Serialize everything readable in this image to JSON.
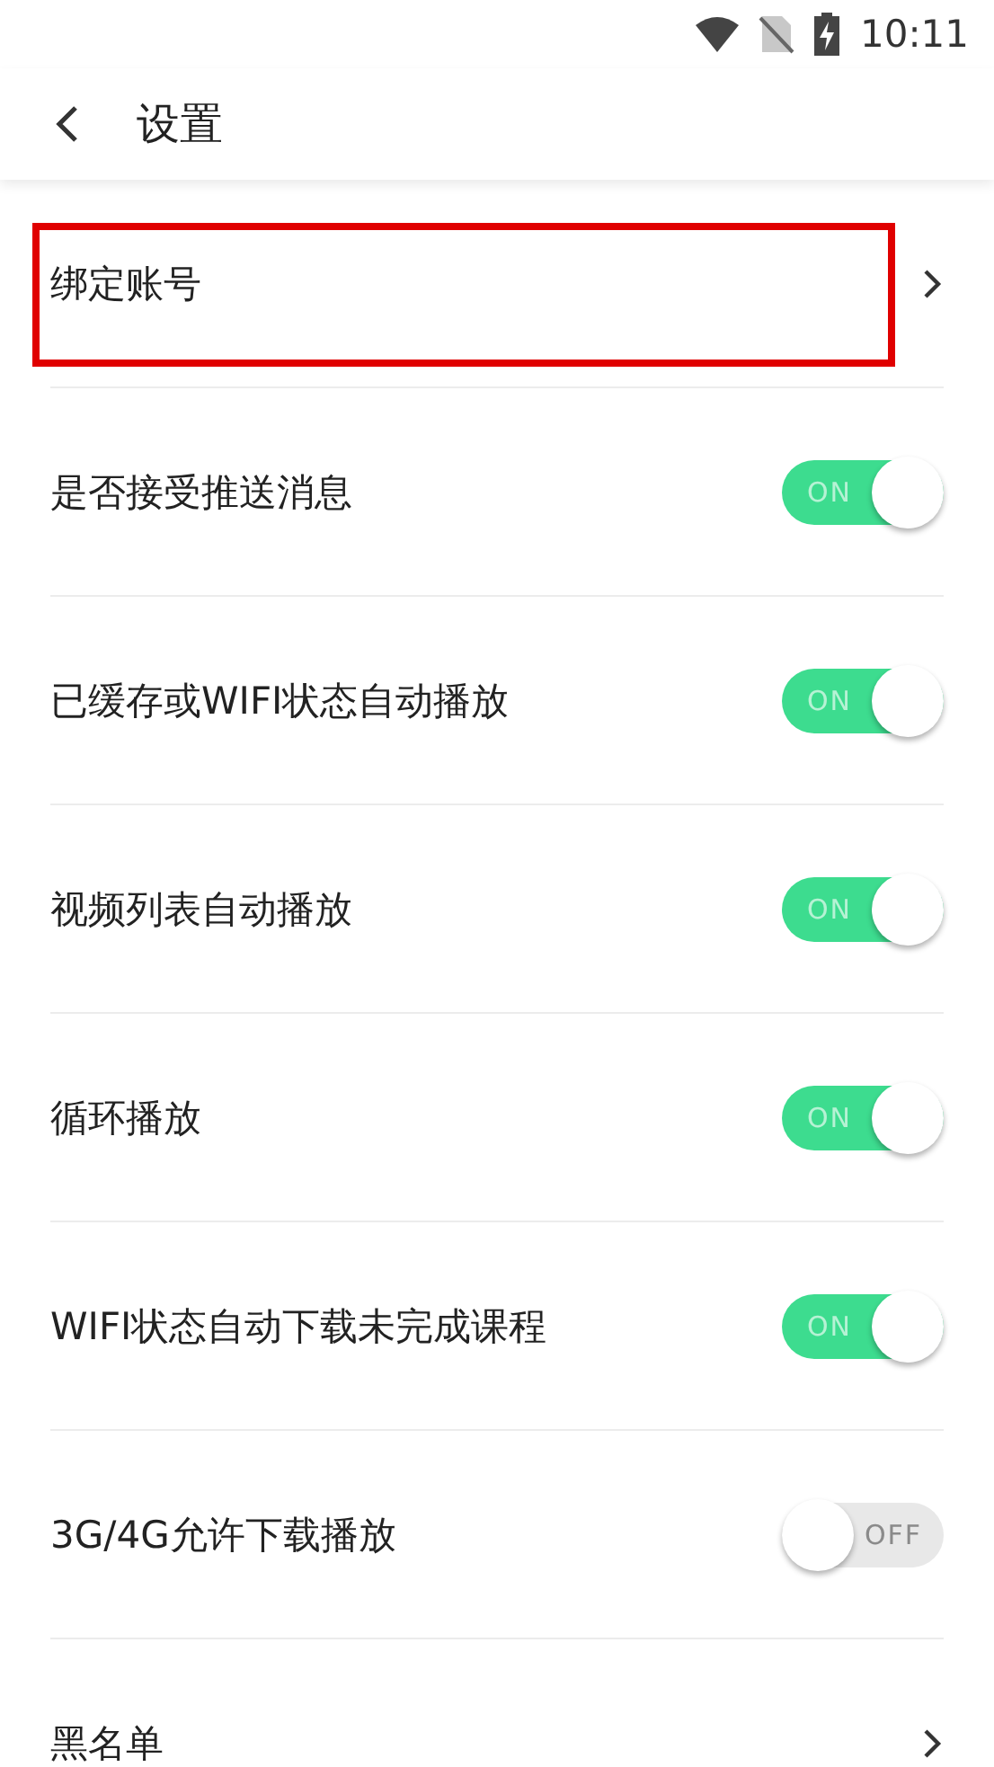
{
  "status_bar": {
    "time": "10:11"
  },
  "header": {
    "title": "设置"
  },
  "items": [
    {
      "kind": "link",
      "label": "绑定账号",
      "highlighted": true
    },
    {
      "kind": "toggle",
      "label": "是否接受推送消息",
      "on": true,
      "toggle_text": "ON"
    },
    {
      "kind": "toggle",
      "label": "已缓存或WIFI状态自动播放",
      "on": true,
      "toggle_text": "ON"
    },
    {
      "kind": "toggle",
      "label": "视频列表自动播放",
      "on": true,
      "toggle_text": "ON"
    },
    {
      "kind": "toggle",
      "label": "循环播放",
      "on": true,
      "toggle_text": "ON"
    },
    {
      "kind": "toggle",
      "label": "WIFI状态自动下载未完成课程",
      "on": true,
      "toggle_text": "ON"
    },
    {
      "kind": "toggle",
      "label": "3G/4G允许下载播放",
      "on": false,
      "toggle_text": "OFF"
    },
    {
      "kind": "link",
      "label": "黑名单",
      "highlighted": false
    }
  ]
}
